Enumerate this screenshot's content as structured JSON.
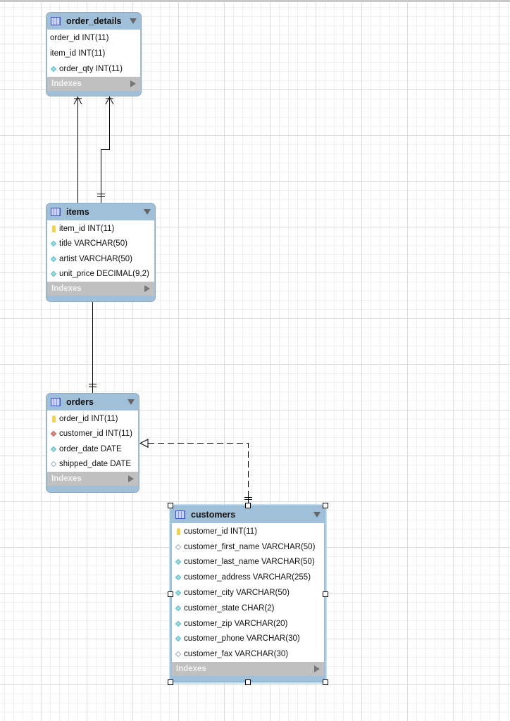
{
  "tables": [
    {
      "name": "order_details",
      "columns": [
        {
          "text": "order_id INT(11)",
          "icon": "none"
        },
        {
          "text": "item_id INT(11)",
          "icon": "none"
        },
        {
          "text": "order_qty INT(11)",
          "icon": "column-diamond-filled"
        }
      ],
      "indexes_label": "Indexes"
    },
    {
      "name": "items",
      "columns": [
        {
          "text": "item_id INT(11)",
          "icon": "primary-key"
        },
        {
          "text": "title VARCHAR(50)",
          "icon": "column-diamond-filled"
        },
        {
          "text": "artist VARCHAR(50)",
          "icon": "column-diamond-filled"
        },
        {
          "text": "unit_price DECIMAL(9,2)",
          "icon": "column-diamond-filled"
        }
      ],
      "indexes_label": "Indexes"
    },
    {
      "name": "orders",
      "columns": [
        {
          "text": "order_id INT(11)",
          "icon": "primary-key"
        },
        {
          "text": "customer_id INT(11)",
          "icon": "foreign-key-diamond"
        },
        {
          "text": "order_date DATE",
          "icon": "column-diamond-filled"
        },
        {
          "text": "shipped_date DATE",
          "icon": "column-diamond-empty"
        }
      ],
      "indexes_label": "Indexes"
    },
    {
      "name": "customers",
      "selected": true,
      "columns": [
        {
          "text": "customer_id INT(11)",
          "icon": "primary-key"
        },
        {
          "text": "customer_first_name VARCHAR(50)",
          "icon": "column-diamond-empty"
        },
        {
          "text": "customer_last_name VARCHAR(50)",
          "icon": "column-diamond-filled"
        },
        {
          "text": "customer_address VARCHAR(255)",
          "icon": "column-diamond-filled"
        },
        {
          "text": "customer_city VARCHAR(50)",
          "icon": "column-diamond-filled"
        },
        {
          "text": "customer_state CHAR(2)",
          "icon": "column-diamond-filled"
        },
        {
          "text": "customer_zip VARCHAR(20)",
          "icon": "column-diamond-filled"
        },
        {
          "text": "customer_phone VARCHAR(30)",
          "icon": "column-diamond-filled"
        },
        {
          "text": "customer_fax VARCHAR(30)",
          "icon": "column-diamond-empty"
        }
      ],
      "indexes_label": "Indexes"
    }
  ],
  "relationships": [
    {
      "from": "order_details",
      "to": "items",
      "style": "solid",
      "from_end": "many",
      "to_end": "one"
    },
    {
      "from": "items",
      "to": "orders",
      "style": "solid",
      "to_end": "one"
    },
    {
      "from": "orders",
      "to": "customers",
      "style": "dashed",
      "from_end": "one-or-many",
      "to_end": "one"
    }
  ],
  "colors": {
    "header": "#a0bfd9",
    "indexes": "#c0c0c0",
    "selection": "#bde3f7"
  }
}
